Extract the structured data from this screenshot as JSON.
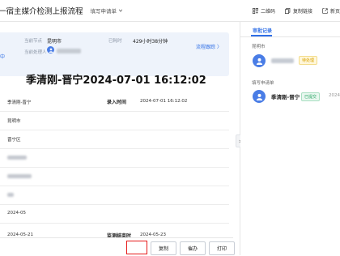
{
  "header": {
    "title": "一宿主媒介检测上报流程",
    "switch_label": "填写申请单",
    "actions": [
      {
        "icon": "qrcode-icon",
        "label": "二维码"
      },
      {
        "icon": "copy-link-icon",
        "label": "复制链接"
      },
      {
        "icon": "new-tab-icon",
        "label": "新页"
      }
    ]
  },
  "summary": {
    "status": "中",
    "region_label": "当前节点",
    "region_value": "昆明市",
    "handler_label": "当前处理人",
    "elapsed_label": "已耗时",
    "elapsed_value": "429小时38分钟",
    "trace_label": "流程跟踪",
    "trace_arrow": "〉"
  },
  "document": {
    "title": "季清刚-晋宁2024-07-01 16:12:02",
    "rows": [
      {
        "value": "季清刚-晋宁",
        "label": "录入时间",
        "value2": "2024-07-01 16:12:02"
      },
      {
        "value": "昆明市"
      },
      {
        "value": "晋宁区"
      },
      {
        "value": ""
      },
      {
        "value": ""
      },
      {
        "value": ""
      },
      {
        "value": "2024-05"
      },
      {
        "value": "2024-05-21",
        "label": "监测结束时",
        "value2": "2024-05-23"
      }
    ]
  },
  "footer": {
    "buttons": [
      "复制",
      "催办",
      "打印"
    ]
  },
  "side": {
    "title": "审批记录",
    "section1": "昆明市",
    "status1": "待处理",
    "section2": "填写申请单",
    "name2": "季清刚-晋宁",
    "status2": "已提交",
    "time2": "2024"
  },
  "colors": {
    "accent": "#2e6ee6",
    "highlight": "#e61a1a"
  }
}
